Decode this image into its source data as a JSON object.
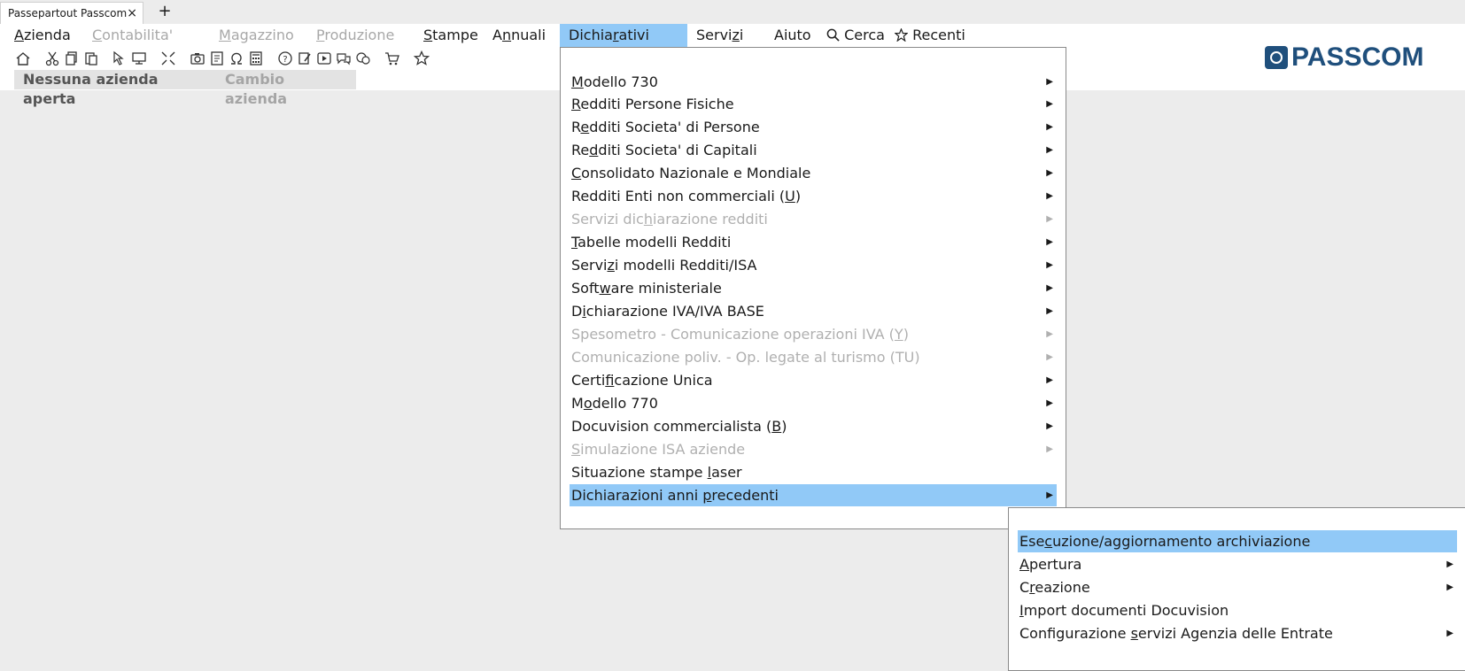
{
  "tabs": {
    "title": "Passepartout Passcom",
    "close_glyph": "×",
    "add_glyph": "+"
  },
  "menubar": {
    "azienda": "Azienda",
    "contabilita": "Contabilita'",
    "magazzino": "Magazzino",
    "produzione": "Produzione",
    "stampe": "Stampe",
    "annuali": "Annuali",
    "dichiarativi": "Dichiarativi",
    "servizi": "Servizi",
    "aiuto": "Aiuto",
    "cerca": "Cerca",
    "recenti": "Recenti"
  },
  "company_tabs": {
    "none_open": "Nessuna azienda aperta",
    "change": "Cambio azienda"
  },
  "logo": {
    "text": "PASSCOM",
    "color": "#1f4f7c"
  },
  "dropdown": {
    "items": [
      {
        "label": "Modello 730",
        "disabled": false
      },
      {
        "label": "Redditi Persone Fisiche",
        "disabled": false
      },
      {
        "label": "Redditi Societa' di Persone",
        "disabled": false
      },
      {
        "label": "Redditi Societa' di Capitali",
        "disabled": false
      },
      {
        "label": "Consolidato Nazionale e Mondiale",
        "disabled": false
      },
      {
        "label": "Redditi Enti non commerciali (U)",
        "disabled": false
      },
      {
        "label": "Servizi dichiarazione redditi",
        "disabled": true
      },
      {
        "label": "Tabelle modelli Redditi",
        "disabled": false
      },
      {
        "label": "Servizi modelli Redditi/ISA",
        "disabled": false
      },
      {
        "label": "Software ministeriale",
        "disabled": false
      },
      {
        "label": "Dichiarazione IVA/IVA BASE",
        "disabled": false
      },
      {
        "label": "Spesometro - Comunicazione operazioni IVA (Y)",
        "disabled": true
      },
      {
        "label": "Comunicazione poliv. - Op. legate al turismo (TU)",
        "disabled": true
      },
      {
        "label": "Certificazione Unica",
        "disabled": false
      },
      {
        "label": "Modello 770",
        "disabled": false
      },
      {
        "label": "Docuvision commercialista (B)",
        "disabled": false
      },
      {
        "label": "Simulazione ISA aziende",
        "disabled": true
      },
      {
        "label": "Situazione stampe laser",
        "disabled": false
      },
      {
        "label": "Dichiarazioni anni precedenti",
        "disabled": false
      }
    ],
    "submenu_arrow": "▶"
  },
  "submenu": {
    "items": [
      {
        "label": "Esecuzione/aggiornamento archiviazione"
      },
      {
        "label": "Apertura"
      },
      {
        "label": "Creazione"
      },
      {
        "label": "Import documenti Docuvision"
      },
      {
        "label": "Configurazione servizi Agenzia delle Entrate"
      }
    ]
  },
  "colors": {
    "highlight": "#91c9f7",
    "disabled_text": "#b0b0b0",
    "background": "#ececec"
  },
  "icons": [
    "home-icon",
    "cut-icon",
    "copy-icon",
    "paste-icon",
    "pointer-icon",
    "monitor-icon",
    "collapse-icon",
    "camera-icon",
    "document-icon",
    "omega-icon",
    "calculator-icon",
    "help-icon",
    "edit-document-icon",
    "video-icon",
    "chat-icon",
    "chat-bubbles-icon",
    "cart-icon",
    "star-icon"
  ]
}
